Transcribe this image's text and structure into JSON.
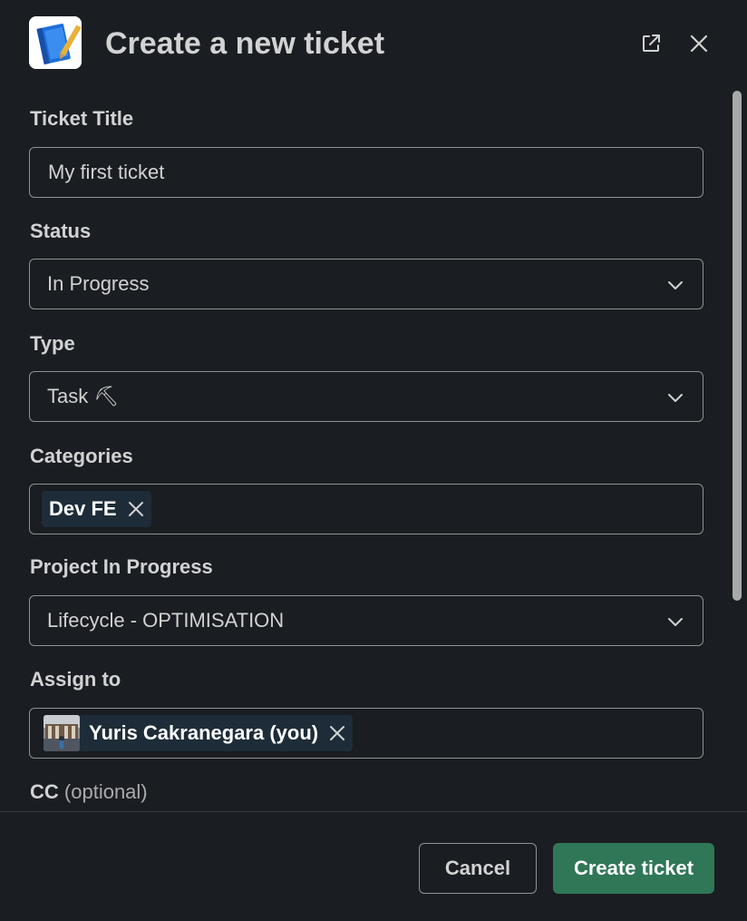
{
  "header": {
    "title": "Create a new ticket",
    "app_icon": "notebook-app-icon",
    "popout_icon": "external-link-icon",
    "close_icon": "close-icon"
  },
  "form": {
    "ticket_title": {
      "label": "Ticket Title",
      "value": "My first ticket"
    },
    "status": {
      "label": "Status",
      "value": "In Progress"
    },
    "type": {
      "label": "Type",
      "value": "Task ⛏"
    },
    "categories": {
      "label": "Categories",
      "chips": [
        "Dev FE"
      ]
    },
    "project": {
      "label": "Project In Progress",
      "value": "Lifecycle - OPTIMISATION"
    },
    "assign_to": {
      "label": "Assign to",
      "chips": [
        "Yuris Cakranegara (you)"
      ]
    },
    "cc": {
      "label": "CC",
      "optional": "(optional)"
    }
  },
  "footer": {
    "cancel_label": "Cancel",
    "submit_label": "Create ticket"
  },
  "colors": {
    "background": "#1a1d21",
    "text": "#d1d2d3",
    "border": "#8f9194",
    "chip_bg": "#1d2c38",
    "primary": "#2f7756"
  }
}
